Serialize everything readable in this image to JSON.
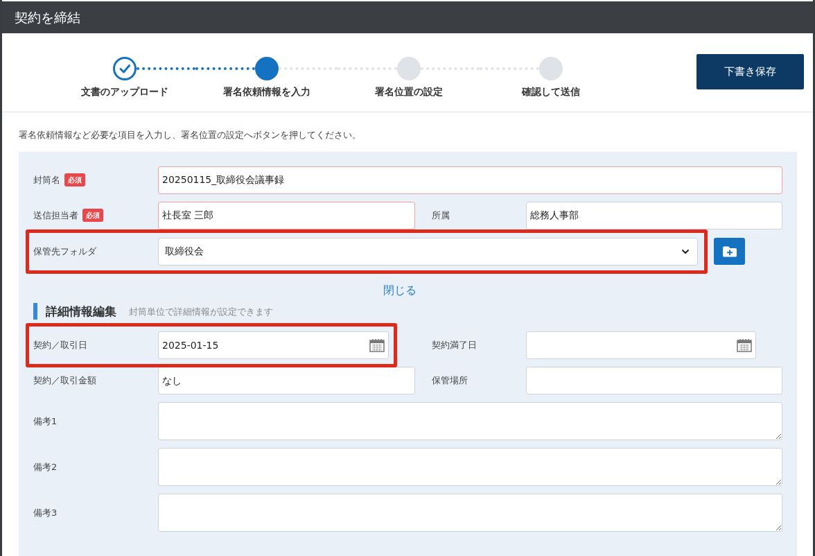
{
  "window": {
    "title": "契約を締結"
  },
  "steps": [
    {
      "label": "文書のアップロード",
      "completed": true,
      "selected": false
    },
    {
      "label": "署名依頼情報を入力",
      "completed": false,
      "selected": true
    },
    {
      "label": "署名位置の設定",
      "completed": false,
      "selected": false
    },
    {
      "label": "確認して送信",
      "completed": false,
      "selected": false
    }
  ],
  "save_draft_button": "下書き保存",
  "instruction": "署名依頼情報など必要な項目を入力し、署名位置の設定へボタンを押してください。",
  "envelope_name": {
    "label": "封筒名",
    "required": true,
    "badge": "必須",
    "value": "20250115_取締役会議事録"
  },
  "sender": {
    "label": "送信担当者",
    "required": true,
    "badge": "必須",
    "value": "社長室 三郎"
  },
  "affiliation": {
    "label": "所属",
    "value": "総務人事部"
  },
  "folder": {
    "label": "保管先フォルダ",
    "value": "取締役会",
    "highlighted": true
  },
  "toggle_link": "閉じる",
  "details": {
    "heading": "詳細情報編集",
    "subheading": "封筒単位で詳細情報が設定できます",
    "contract_date": {
      "label": "契約／取引日",
      "value": "2025-01-15",
      "highlighted": true
    },
    "expiry_date": {
      "label": "契約満了日"
    },
    "amount": {
      "label": "契約／取引金額",
      "value": "なし"
    },
    "storage_location": {
      "label": "保管場所"
    },
    "remarks": [
      {
        "label": "備考1"
      },
      {
        "label": "備考2"
      },
      {
        "label": "備考3"
      }
    ]
  }
}
